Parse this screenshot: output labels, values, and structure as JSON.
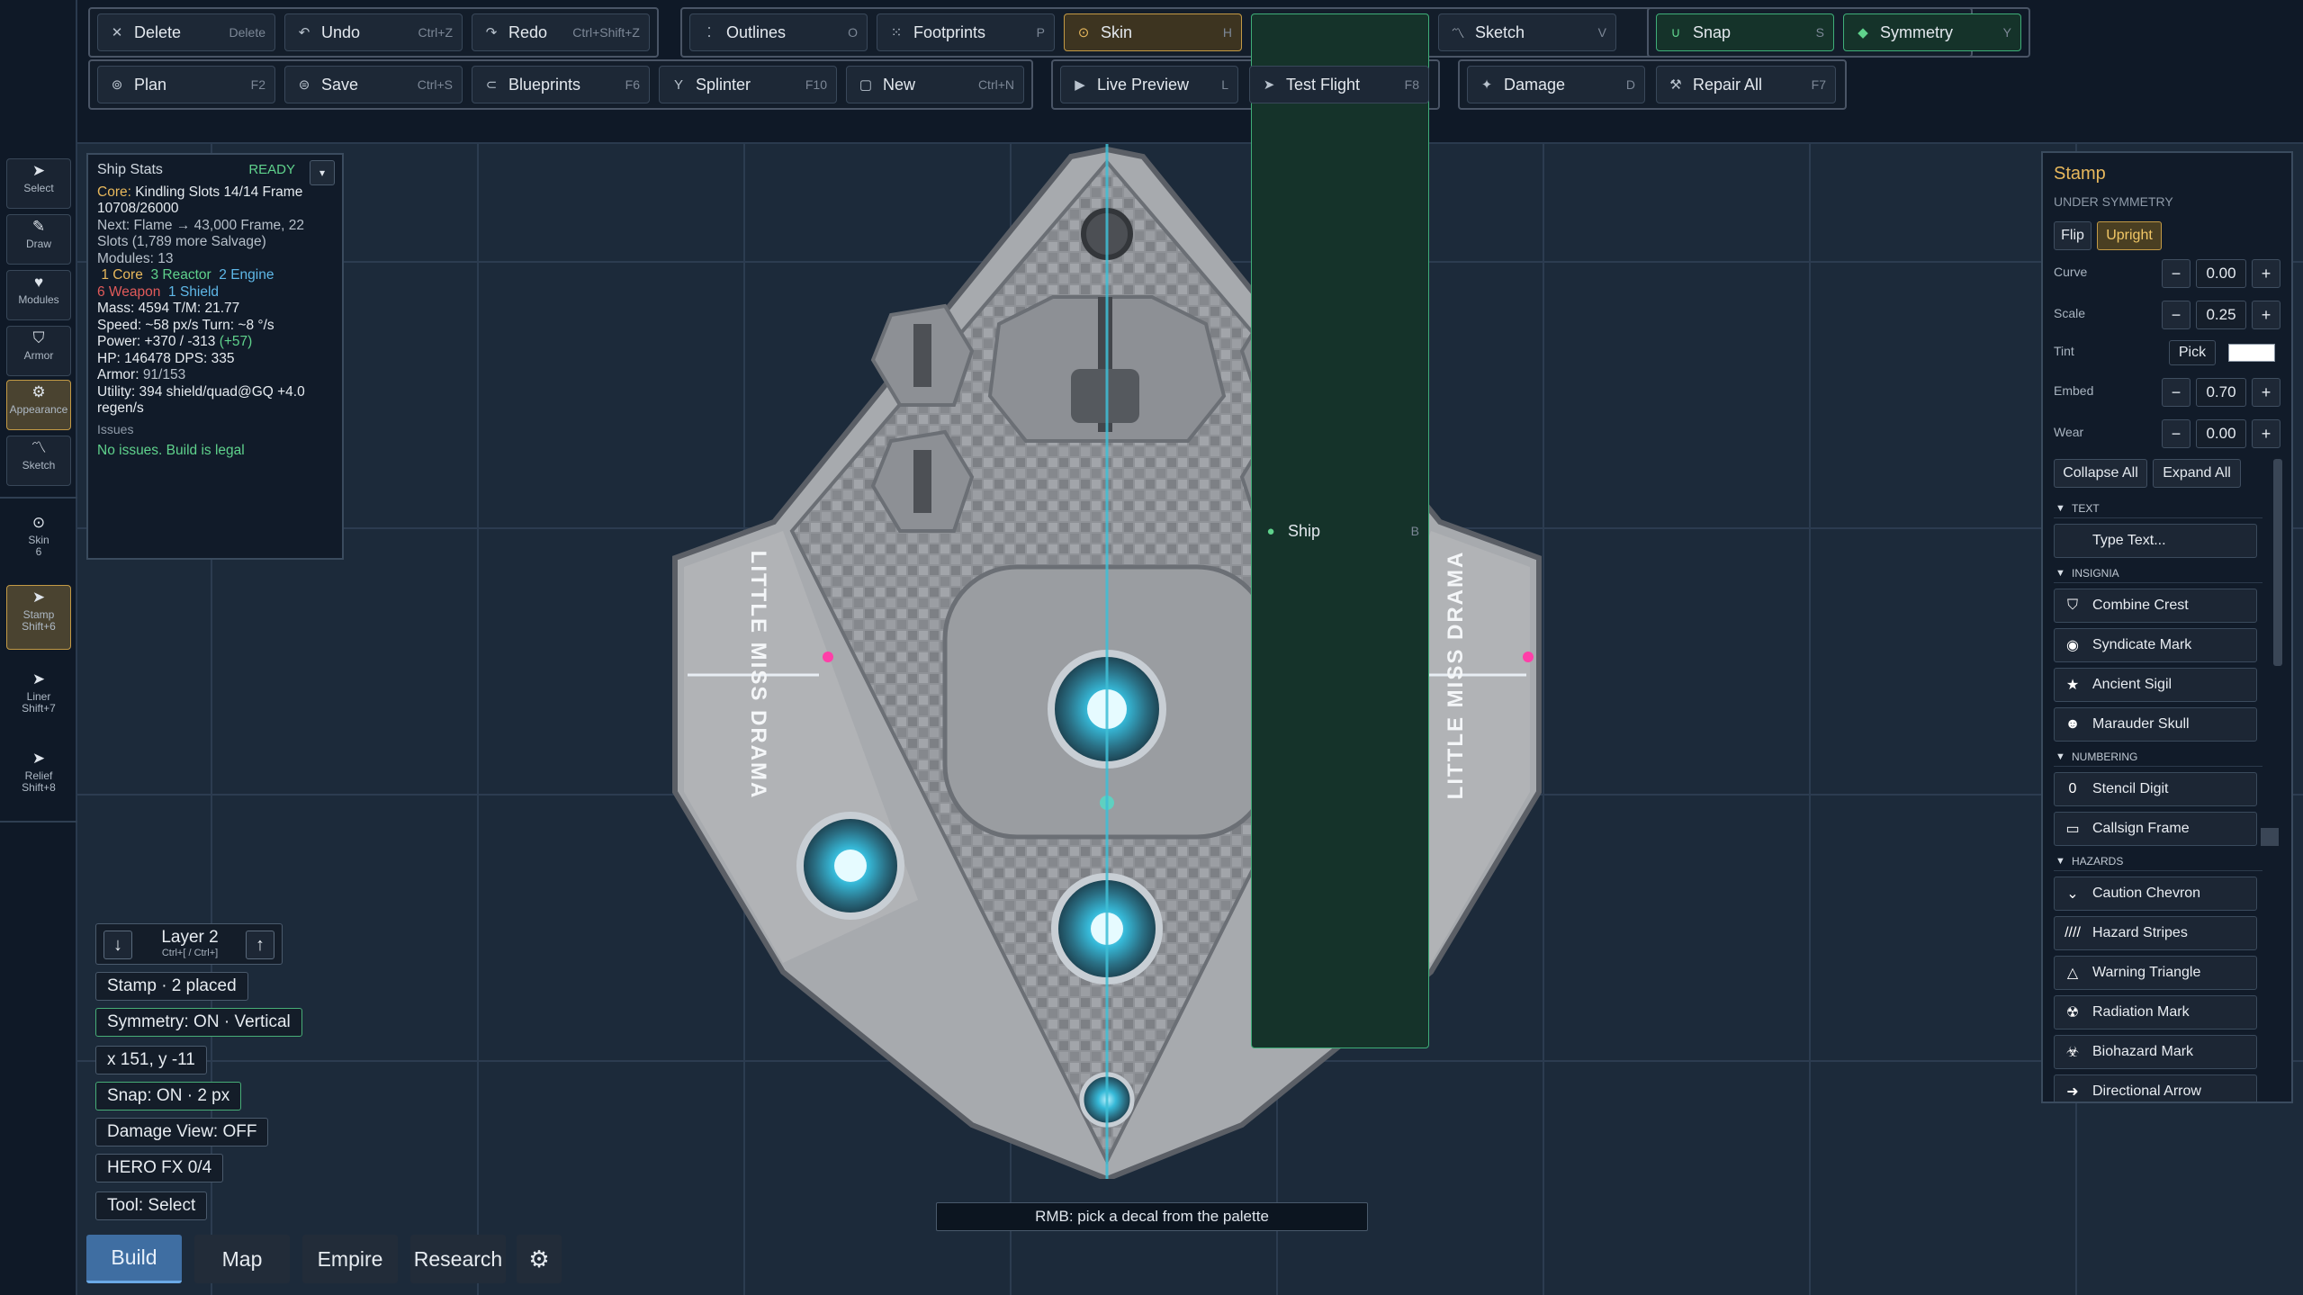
{
  "toolbar": {
    "row1": [
      {
        "label": "Delete",
        "shortcut": "Delete",
        "icon": "close-icon"
      },
      {
        "label": "Undo",
        "shortcut": "Ctrl+Z",
        "icon": "undo-icon"
      },
      {
        "label": "Redo",
        "shortcut": "Ctrl+Shift+Z",
        "icon": "redo-icon"
      },
      {
        "label": "Outlines",
        "shortcut": "O",
        "icon": "outline-icon"
      },
      {
        "label": "Footprints",
        "shortcut": "P",
        "icon": "footprint-icon"
      },
      {
        "label": "Skin",
        "shortcut": "H",
        "icon": "skin-icon"
      },
      {
        "label": "Ship",
        "shortcut": "B",
        "icon": "ship-icon"
      },
      {
        "label": "Sketch",
        "shortcut": "V",
        "icon": "sketch-icon"
      },
      {
        "label": "Snap",
        "shortcut": "S",
        "icon": "magnet-icon"
      },
      {
        "label": "Symmetry",
        "shortcut": "Y",
        "icon": "symmetry-icon"
      }
    ],
    "row2": [
      {
        "label": "Plan",
        "shortcut": "F2",
        "icon": "plan-icon"
      },
      {
        "label": "Save",
        "shortcut": "Ctrl+S",
        "icon": "save-icon"
      },
      {
        "label": "Blueprints",
        "shortcut": "F6",
        "icon": "blueprint-icon"
      },
      {
        "label": "Splinter",
        "shortcut": "F10",
        "icon": "splinter-icon"
      },
      {
        "label": "New",
        "shortcut": "Ctrl+N",
        "icon": "new-icon"
      },
      {
        "label": "Live Preview",
        "shortcut": "L",
        "icon": "play-icon"
      },
      {
        "label": "Test Flight",
        "shortcut": "F8",
        "icon": "flight-icon"
      },
      {
        "label": "Damage",
        "shortcut": "D",
        "icon": "damage-icon"
      },
      {
        "label": "Repair All",
        "shortcut": "F7",
        "icon": "wrench-icon"
      }
    ]
  },
  "rail": [
    {
      "label": "Select",
      "shortcut": "",
      "icon": "cursor-icon"
    },
    {
      "label": "Draw",
      "shortcut": "",
      "icon": "pencil-icon"
    },
    {
      "label": "Modules",
      "shortcut": "",
      "icon": "modules-icon"
    },
    {
      "label": "Armor",
      "shortcut": "",
      "icon": "shield-icon"
    },
    {
      "label": "Appearance",
      "shortcut": "",
      "icon": "appearance-icon"
    },
    {
      "label": "Sketch",
      "shortcut": "",
      "icon": "sketch-icon"
    },
    {
      "label": "Skin",
      "shortcut": "6",
      "icon": "skin-icon"
    },
    {
      "label": "Stamp",
      "shortcut": "Shift+6",
      "icon": "stamp-icon"
    },
    {
      "label": "Liner",
      "shortcut": "Shift+7",
      "icon": "liner-icon"
    },
    {
      "label": "Relief",
      "shortcut": "Shift+8",
      "icon": "relief-icon"
    }
  ],
  "stats": {
    "title": "Ship Stats",
    "status": "READY",
    "core_label": "Core:",
    "core_text": "Kindling  Slots 14/14  Frame 10708/26000",
    "next": "Next: Flame → 43,000 Frame, 22 Slots (1,789 more Salvage)",
    "modules": "Modules: 13",
    "counts": [
      {
        "text": "1 Core",
        "color": "#e8b85c"
      },
      {
        "text": "3 Reactor",
        "color": "#5fd28c"
      },
      {
        "text": "2 Engine",
        "color": "#5fb8e8"
      },
      {
        "text": "6 Weapon",
        "color": "#e05a5a"
      },
      {
        "text": "1 Shield",
        "color": "#5fb8e8"
      }
    ],
    "mass": "Mass: 4594   T/M: 21.77",
    "speed": "Speed: ~58 px/s   Turn: ~8 °/s",
    "power_prefix": "Power: +370 / -313",
    "power_delta": "(+57)",
    "hp": "HP: 146478   DPS: 335",
    "armor_label": "Armor:",
    "armor_value": "91/153",
    "utility": "Utility: 394 shield/quad@GQ +4.0 regen/s",
    "issues_label": "Issues",
    "issues_text": "No issues. Build is legal"
  },
  "stamp_panel": {
    "title": "Stamp",
    "subtitle": "UNDER SYMMETRY",
    "flip": "Flip",
    "upright": "Upright",
    "params": [
      {
        "label": "Curve",
        "value": "0.00"
      },
      {
        "label": "Scale",
        "value": "0.25"
      },
      {
        "label": "Tint",
        "value": ""
      },
      {
        "label": "Embed",
        "value": "0.70"
      },
      {
        "label": "Wear",
        "value": "0.00"
      }
    ],
    "pick": "Pick",
    "tint_color": "#ffffff",
    "collapse_all": "Collapse All",
    "expand_all": "Expand All",
    "sections": [
      {
        "title": "TEXT",
        "items": [
          {
            "label": "Type Text...",
            "icon": ""
          }
        ]
      },
      {
        "title": "INSIGNIA",
        "items": [
          {
            "label": "Combine Crest",
            "icon": "crest-icon"
          },
          {
            "label": "Syndicate Mark",
            "icon": "syndicate-icon"
          },
          {
            "label": "Ancient Sigil",
            "icon": "star-icon"
          },
          {
            "label": "Marauder Skull",
            "icon": "skull-icon"
          }
        ]
      },
      {
        "title": "NUMBERING",
        "items": [
          {
            "label": "Stencil Digit",
            "icon": "digit-icon"
          },
          {
            "label": "Callsign Frame",
            "icon": "frame-icon"
          }
        ]
      },
      {
        "title": "HAZARDS",
        "items": [
          {
            "label": "Caution Chevron",
            "icon": "chevron-icon"
          },
          {
            "label": "Hazard Stripes",
            "icon": "stripes-icon"
          },
          {
            "label": "Warning Triangle",
            "icon": "warning-icon"
          },
          {
            "label": "Radiation Mark",
            "icon": "radiation-icon"
          },
          {
            "label": "Biohazard Mark",
            "icon": "biohazard-icon"
          },
          {
            "label": "Directional Arrow",
            "icon": "arrow-icon"
          }
        ]
      }
    ]
  },
  "ship": {
    "decal_text": "LITTLE MISS DRAMA"
  },
  "overlay": {
    "layer": "Layer 2",
    "layer_shortcut": "Ctrl+[ / Ctrl+]",
    "stamp_placed": "Stamp · 2 placed",
    "symmetry": "Symmetry: ON · Vertical",
    "coords": "x 151, y -11",
    "snap": "Snap: ON · 2 px",
    "damage": "Damage View: OFF",
    "hero": "HERO FX 0/4",
    "tool": "Tool: Select"
  },
  "tabs": [
    "Build",
    "Map",
    "Empire",
    "Research"
  ],
  "hint": "RMB: pick a decal from the palette",
  "colors": {
    "accent": "#e8b85c",
    "green": "#3fae79",
    "active_tab": "#3f6ea2"
  }
}
